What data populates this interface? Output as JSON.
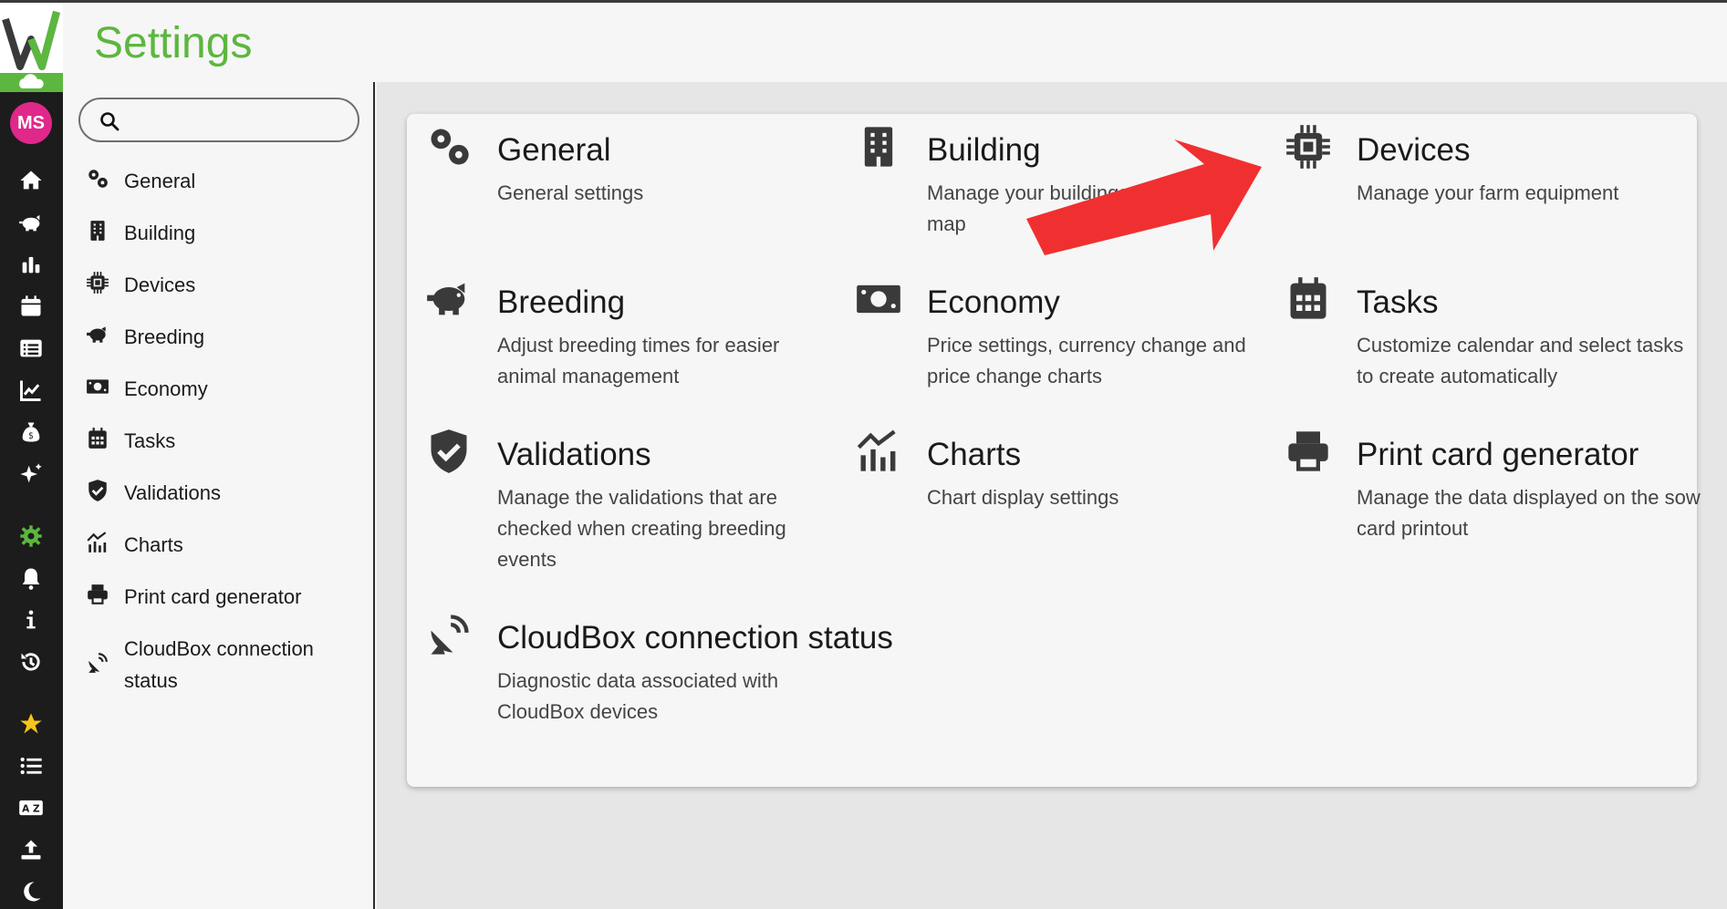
{
  "app": {
    "title": "Settings",
    "avatar_initials": "MS",
    "accent_color": "#5cb73f",
    "avatar_color": "#e0288a"
  },
  "rail": {
    "items": [
      {
        "icon": "home-icon"
      },
      {
        "icon": "pig-icon"
      },
      {
        "icon": "bar-chart-icon"
      },
      {
        "icon": "calendar-icon"
      },
      {
        "icon": "list-icon"
      },
      {
        "icon": "line-chart-icon"
      },
      {
        "icon": "money-bag-icon"
      },
      {
        "icon": "sparkles-icon"
      },
      {
        "icon": "gear-icon"
      },
      {
        "icon": "bell-icon"
      },
      {
        "icon": "info-icon"
      },
      {
        "icon": "history-icon"
      },
      {
        "icon": "star-icon"
      },
      {
        "icon": "list-bullets-icon"
      },
      {
        "icon": "translate-icon"
      },
      {
        "icon": "upload-icon"
      },
      {
        "icon": "moon-icon"
      }
    ]
  },
  "search": {
    "placeholder": ""
  },
  "subnav": {
    "items": [
      {
        "label": "General",
        "icon": "gears-icon"
      },
      {
        "label": "Building",
        "icon": "building-icon"
      },
      {
        "label": "Devices",
        "icon": "chip-icon"
      },
      {
        "label": "Breeding",
        "icon": "pig-icon"
      },
      {
        "label": "Economy",
        "icon": "money-icon"
      },
      {
        "label": "Tasks",
        "icon": "calendar-icon"
      },
      {
        "label": "Validations",
        "icon": "shield-check-icon"
      },
      {
        "label": "Charts",
        "icon": "chart-icon"
      },
      {
        "label": "Print card generator",
        "icon": "printer-icon"
      },
      {
        "label": "CloudBox connection status",
        "icon": "satellite-dish-icon"
      }
    ]
  },
  "tiles": [
    {
      "title": "General",
      "desc": "General settings",
      "icon": "gears-icon"
    },
    {
      "title": "Building",
      "desc": "Manage your buildings map",
      "icon": "building-icon"
    },
    {
      "title": "Devices",
      "desc": "Manage your farm equipment",
      "icon": "chip-icon"
    },
    {
      "title": "Breeding",
      "desc": "Adjust breeding times for easier animal management",
      "icon": "pig-icon"
    },
    {
      "title": "Economy",
      "desc": "Price settings, currency change and price change charts",
      "icon": "money-icon"
    },
    {
      "title": "Tasks",
      "desc": "Customize calendar and select tasks to create automatically",
      "icon": "calendar-icon"
    },
    {
      "title": "Validations",
      "desc": "Manage the validations that are checked when creating breeding events",
      "icon": "shield-check-icon"
    },
    {
      "title": "Charts",
      "desc": "Chart display settings",
      "icon": "chart-icon"
    },
    {
      "title": "Print card generator",
      "desc": "Manage the data displayed on the sow card printout",
      "icon": "printer-icon"
    },
    {
      "title": "CloudBox connection status",
      "desc": "Diagnostic data associated with CloudBox devices",
      "icon": "satellite-dish-icon"
    }
  ],
  "annotation": {
    "arrow_color": "#f03030"
  }
}
